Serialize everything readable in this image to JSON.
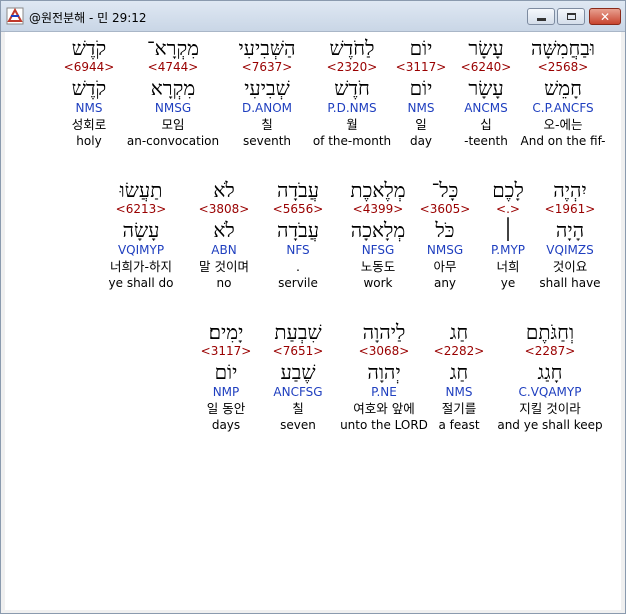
{
  "window": {
    "title": "@원전분해 - 민 29:12"
  },
  "rows": [
    [
      {
        "heb": "וּבַחֲמִשָּׁה",
        "strong": "<2568>",
        "root": "חָמֵשׁ",
        "parse": "C.P.ANCFS",
        "korean": "오-에는",
        "english": "And on the fif-"
      },
      {
        "heb": "עָשָׂר",
        "strong": "<6240>",
        "root": "עָשָׂר",
        "parse": "ANCMS",
        "korean": "십",
        "english": "-teenth"
      },
      {
        "heb": "יוֹם",
        "strong": "<3117>",
        "root": "יוֹם",
        "parse": "NMS",
        "korean": "일",
        "english": "day"
      },
      {
        "heb": "לַחֹדֶשׁ",
        "strong": "<2320>",
        "root": "חֹדֶשׁ",
        "parse": "P.D.NMS",
        "korean": "월",
        "english": "of the-month"
      },
      {
        "heb": "הַשְּׁבִיעִי",
        "strong": "<7637>",
        "root": "שְׁבִיעִי",
        "parse": "D.ANOM",
        "korean": "칠",
        "english": "seventh"
      },
      {
        "heb": "מִקְרָא־",
        "strong": "<4744>",
        "root": "מִקְרָא",
        "parse": "NMSG",
        "korean": "모임",
        "english": "an-convocation"
      },
      {
        "heb": "קֹדֶשׁ",
        "strong": "<6944>",
        "root": "קֹדֶשׁ",
        "parse": "NMS",
        "korean": "성회로",
        "english": "holy"
      }
    ],
    [
      {
        "heb": "יִהְיֶה",
        "strong": "<1961>",
        "root": "הָיָה",
        "parse": "VQIMZS",
        "korean": "것이요",
        "english": "shall have"
      },
      {
        "heb": "לָכֶם",
        "strong": "<.>",
        "root": "׀",
        "parse": "P.MYP",
        "korean": "너희",
        "english": "ye"
      },
      {
        "heb": "כָּל־",
        "strong": "<3605>",
        "root": "כֹּל",
        "parse": "NMSG",
        "korean": "아무",
        "english": "any"
      },
      {
        "heb": "מְלֶאכֶת",
        "strong": "<4399>",
        "root": "מְלָאכָה",
        "parse": "NFSG",
        "korean": "노동도",
        "english": "work"
      },
      {
        "heb": "עֲבֹדָה",
        "strong": "<5656>",
        "root": "עֲבֹדָה",
        "parse": "NFS",
        "korean": ".",
        "english": "servile"
      },
      {
        "heb": "לֹא",
        "strong": "<3808>",
        "root": "לֹא",
        "parse": "ABN",
        "korean": "말 것이며",
        "english": "no"
      },
      {
        "heb": "תַעֲשׂוּ",
        "strong": "<6213>",
        "root": "עָשָׂה",
        "parse": "VQIMYP",
        "korean": "너희가-하지",
        "english": "ye shall do"
      }
    ],
    [
      {
        "heb": "וְחַגֹּתֶם",
        "strong": "<2287>",
        "root": "חָגַג",
        "parse": "C.VQAMYP",
        "korean": "지킬 것이라",
        "english": "and ye shall keep"
      },
      {
        "heb": "חַג",
        "strong": "<2282>",
        "root": "חַג",
        "parse": "NMS",
        "korean": "절기를",
        "english": "a feast"
      },
      {
        "heb": "לַיהוָה",
        "strong": "<3068>",
        "root": "יְהוָה",
        "parse": "P.NE",
        "korean": "여호와 앞에",
        "english": "unto the LORD"
      },
      {
        "heb": "שִׁבְעַת",
        "strong": "<7651>",
        "root": "שֶׁבַע",
        "parse": "ANCFSG",
        "korean": "칠",
        "english": "seven"
      },
      {
        "heb": "יָמִים׃",
        "strong": "<3117>",
        "root": "יוֹם",
        "parse": "NMP",
        "korean": "일 동안",
        "english": "days"
      }
    ]
  ],
  "icons": {
    "app": "app-logo-icon",
    "minimize": "minimize-icon",
    "maximize": "maximize-icon",
    "close": "close-icon"
  }
}
